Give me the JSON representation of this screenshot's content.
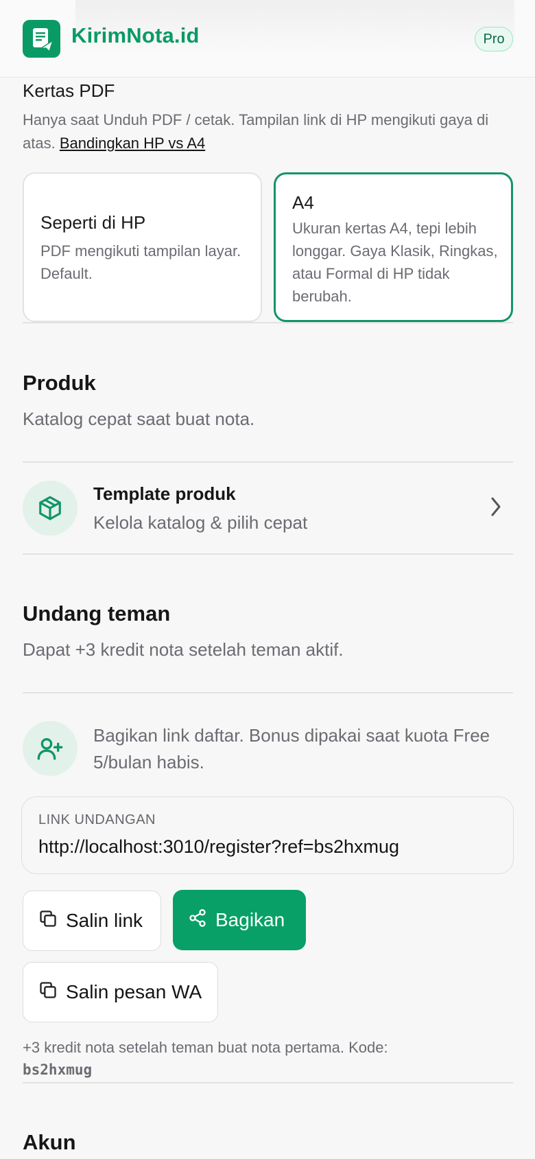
{
  "header": {
    "brand": "KirimNota.id",
    "badge": "Pro",
    "logo_icon": "receipt-send-icon",
    "accent_color": "#0a9a66"
  },
  "kertas": {
    "title": "Kertas PDF",
    "description": "Hanya saat Unduh PDF / cetak. Tampilan link di HP mengikuti gaya di atas.",
    "compare_link": "Bandingkan HP vs A4",
    "options": [
      {
        "title": "Seperti di HP",
        "description": "PDF mengikuti tampilan layar. Default.",
        "selected": false
      },
      {
        "title": "A4",
        "description": "Ukuran kertas A4, tepi lebih longgar. Gaya Klasik, Ringkas, atau Formal di HP tidak berubah.",
        "selected": true
      }
    ]
  },
  "produk": {
    "title": "Produk",
    "subtitle": "Katalog cepat saat buat nota.",
    "row": {
      "icon": "package-icon",
      "title": "Template produk",
      "subtitle": "Kelola katalog & pilih cepat"
    }
  },
  "undang": {
    "title": "Undang teman",
    "subtitle": "Dapat +3 kredit nota setelah teman aktif.",
    "info_icon": "user-plus-icon",
    "info_text": "Bagikan link daftar. Bonus dipakai saat kuota Free 5/bulan habis.",
    "link_label": "LINK UNDANGAN",
    "link_value": "http://localhost:3010/register?ref=bs2hxmug",
    "buttons": {
      "copy_link": "Salin link",
      "share": "Bagikan",
      "copy_wa": "Salin pesan WA"
    },
    "footnote": "+3 kredit nota setelah teman buat nota pertama. Kode:",
    "code": "bs2hxmug"
  },
  "akun": {
    "title": "Akun"
  }
}
